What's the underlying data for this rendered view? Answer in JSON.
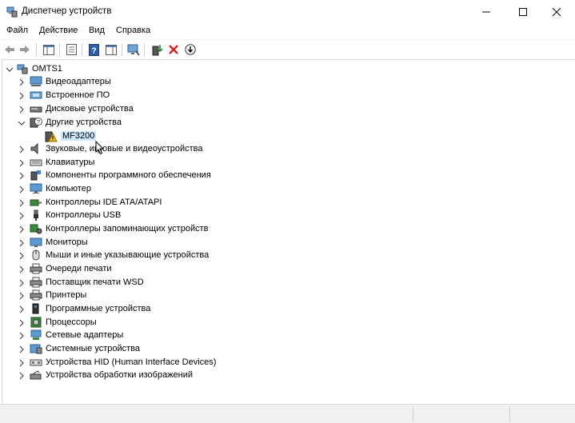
{
  "window": {
    "title": "Диспетчер устройств"
  },
  "menu": [
    "Файл",
    "Действие",
    "Вид",
    "Справка"
  ],
  "tree": {
    "root": "OMTS1",
    "items": [
      "Видеоадаптеры",
      "Встроенное ПО",
      "Дисковые устройства",
      "Другие устройства",
      "MF3200",
      "Звуковые, игровые и видеоустройства",
      "Клавиатуры",
      "Компоненты программного обеспечения",
      "Компьютер",
      "Контроллеры IDE ATA/ATAPI",
      "Контроллеры USB",
      "Контроллеры запоминающих устройств",
      "Мониторы",
      "Мыши и иные указывающие устройства",
      "Очереди печати",
      "Поставщик печати WSD",
      "Принтеры",
      "Программные устройства",
      "Процессоры",
      "Сетевые адаптеры",
      "Системные устройства",
      "Устройства HID (Human Interface Devices)",
      "Устройства обработки изображений"
    ]
  },
  "colors": {
    "selection": "#cce8ff",
    "warning": "#f5c400",
    "delete": "#d81e1e",
    "enable": "#1b8c2e"
  }
}
